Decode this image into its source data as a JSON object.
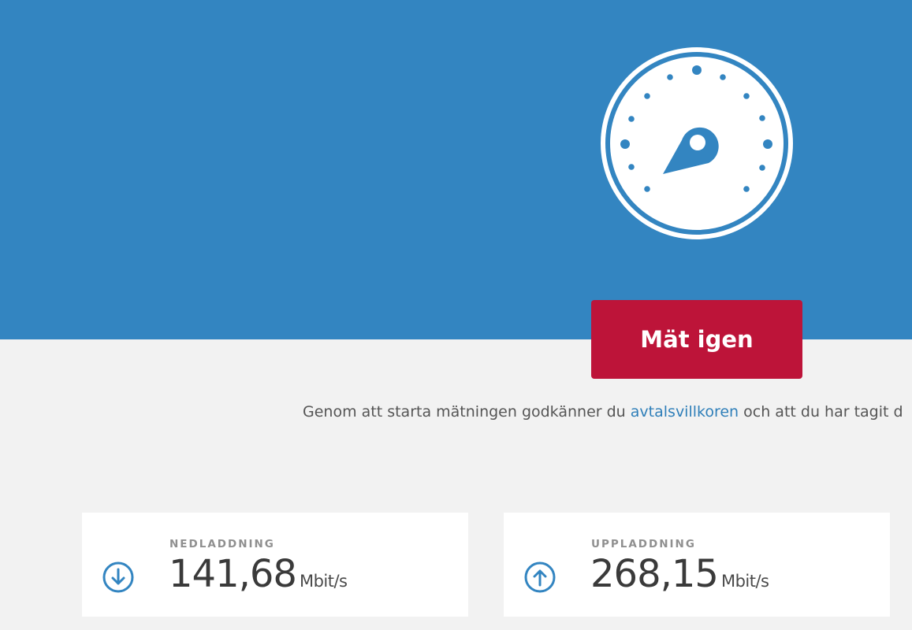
{
  "hero": {
    "background_color": "#3385c1",
    "gauge_icon": "speedometer-icon"
  },
  "actions": {
    "measure_again_label": "Mät igen",
    "button_color": "#bd1439"
  },
  "terms": {
    "prefix": "Genom att starta mätningen godkänner du",
    "link_text": "avtalsvillkoren",
    "suffix": "och att du har tagit d"
  },
  "results": {
    "download": {
      "label": "NEDLADDNING",
      "value": "141,68",
      "unit": "Mbit/s",
      "icon": "arrow-down-circle-icon"
    },
    "upload": {
      "label": "UPPLADDNING",
      "value": "268,15",
      "unit": "Mbit/s",
      "icon": "arrow-up-circle-icon"
    }
  }
}
